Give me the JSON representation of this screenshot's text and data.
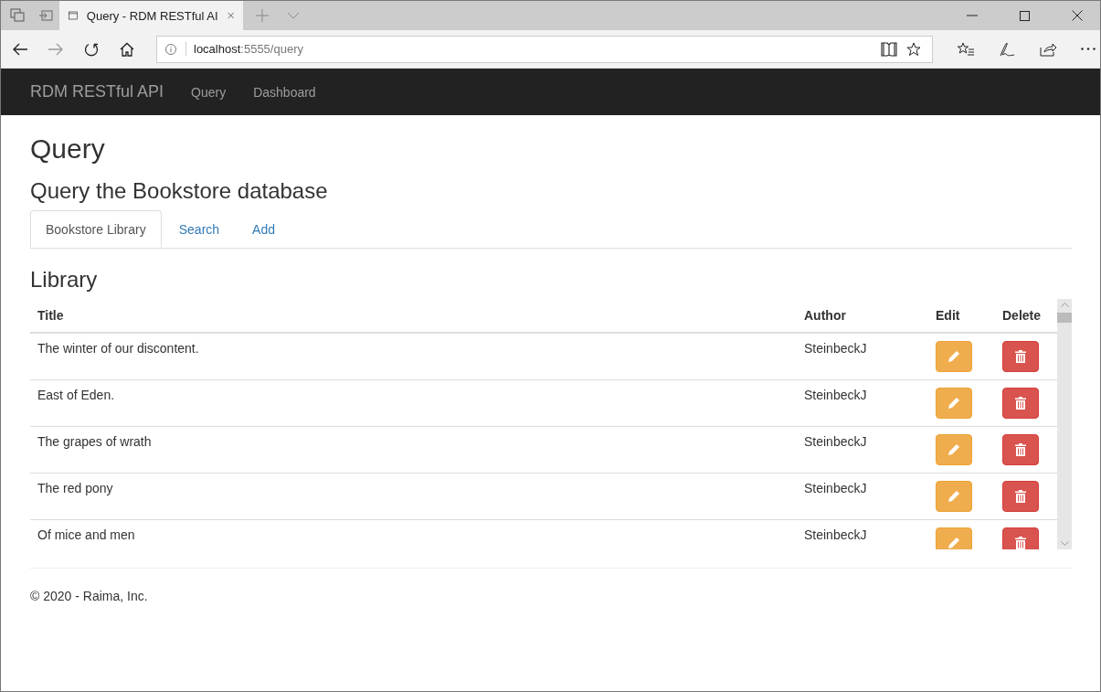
{
  "browser": {
    "tab_title": "Query - RDM RESTful AI",
    "url_host": "localhost",
    "url_path": ":5555/query"
  },
  "navbar": {
    "brand": "RDM RESTful API",
    "links": [
      {
        "label": "Query"
      },
      {
        "label": "Dashboard"
      }
    ]
  },
  "page": {
    "title": "Query",
    "subtitle": "Query the Bookstore database"
  },
  "tabs": [
    {
      "label": "Bookstore Library",
      "selected": true
    },
    {
      "label": "Search",
      "selected": false
    },
    {
      "label": "Add",
      "selected": false
    }
  ],
  "library": {
    "heading": "Library",
    "columns": [
      "Title",
      "Author",
      "Edit",
      "Delete"
    ],
    "rows": [
      {
        "title": "The winter of our discontent.",
        "author": "SteinbeckJ"
      },
      {
        "title": "East of Eden.",
        "author": "SteinbeckJ"
      },
      {
        "title": "The grapes of wrath",
        "author": "SteinbeckJ"
      },
      {
        "title": "The red pony",
        "author": "SteinbeckJ"
      },
      {
        "title": "Of mice and men",
        "author": "SteinbeckJ"
      }
    ]
  },
  "footer": "© 2020 - Raima, Inc."
}
